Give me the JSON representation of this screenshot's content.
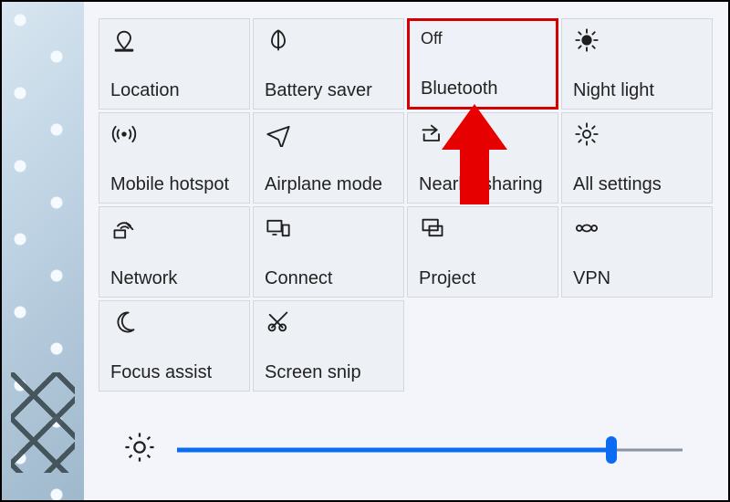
{
  "tiles": [
    {
      "id": "location",
      "label": "Location",
      "status": "",
      "icon": "location-icon"
    },
    {
      "id": "battery-saver",
      "label": "Battery saver",
      "status": "",
      "icon": "leaf-icon"
    },
    {
      "id": "bluetooth",
      "label": "Bluetooth",
      "status": "Off",
      "icon": "",
      "highlight": true
    },
    {
      "id": "night-light",
      "label": "Night light",
      "status": "",
      "icon": "night-light-icon"
    },
    {
      "id": "mobile-hotspot",
      "label": "Mobile hotspot",
      "status": "",
      "icon": "hotspot-icon"
    },
    {
      "id": "airplane-mode",
      "label": "Airplane mode",
      "status": "",
      "icon": "airplane-icon"
    },
    {
      "id": "nearby-sharing",
      "label": "Nearby sharing",
      "status": "",
      "icon": "share-icon"
    },
    {
      "id": "all-settings",
      "label": "All settings",
      "status": "",
      "icon": "gear-icon"
    },
    {
      "id": "network",
      "label": "Network",
      "status": "",
      "icon": "network-icon"
    },
    {
      "id": "connect",
      "label": "Connect",
      "status": "",
      "icon": "connect-icon"
    },
    {
      "id": "project",
      "label": "Project",
      "status": "",
      "icon": "project-icon"
    },
    {
      "id": "vpn",
      "label": "VPN",
      "status": "",
      "icon": "vpn-icon"
    },
    {
      "id": "focus-assist",
      "label": "Focus assist",
      "status": "",
      "icon": "moon-icon"
    },
    {
      "id": "screen-snip",
      "label": "Screen snip",
      "status": "",
      "icon": "snip-icon"
    }
  ],
  "brightness": {
    "percent": 86
  },
  "annotation": {
    "arrow_target": "bluetooth"
  },
  "colors": {
    "accent": "#0a6cf0",
    "highlight_border": "#d40000",
    "arrow": "#e60000"
  }
}
